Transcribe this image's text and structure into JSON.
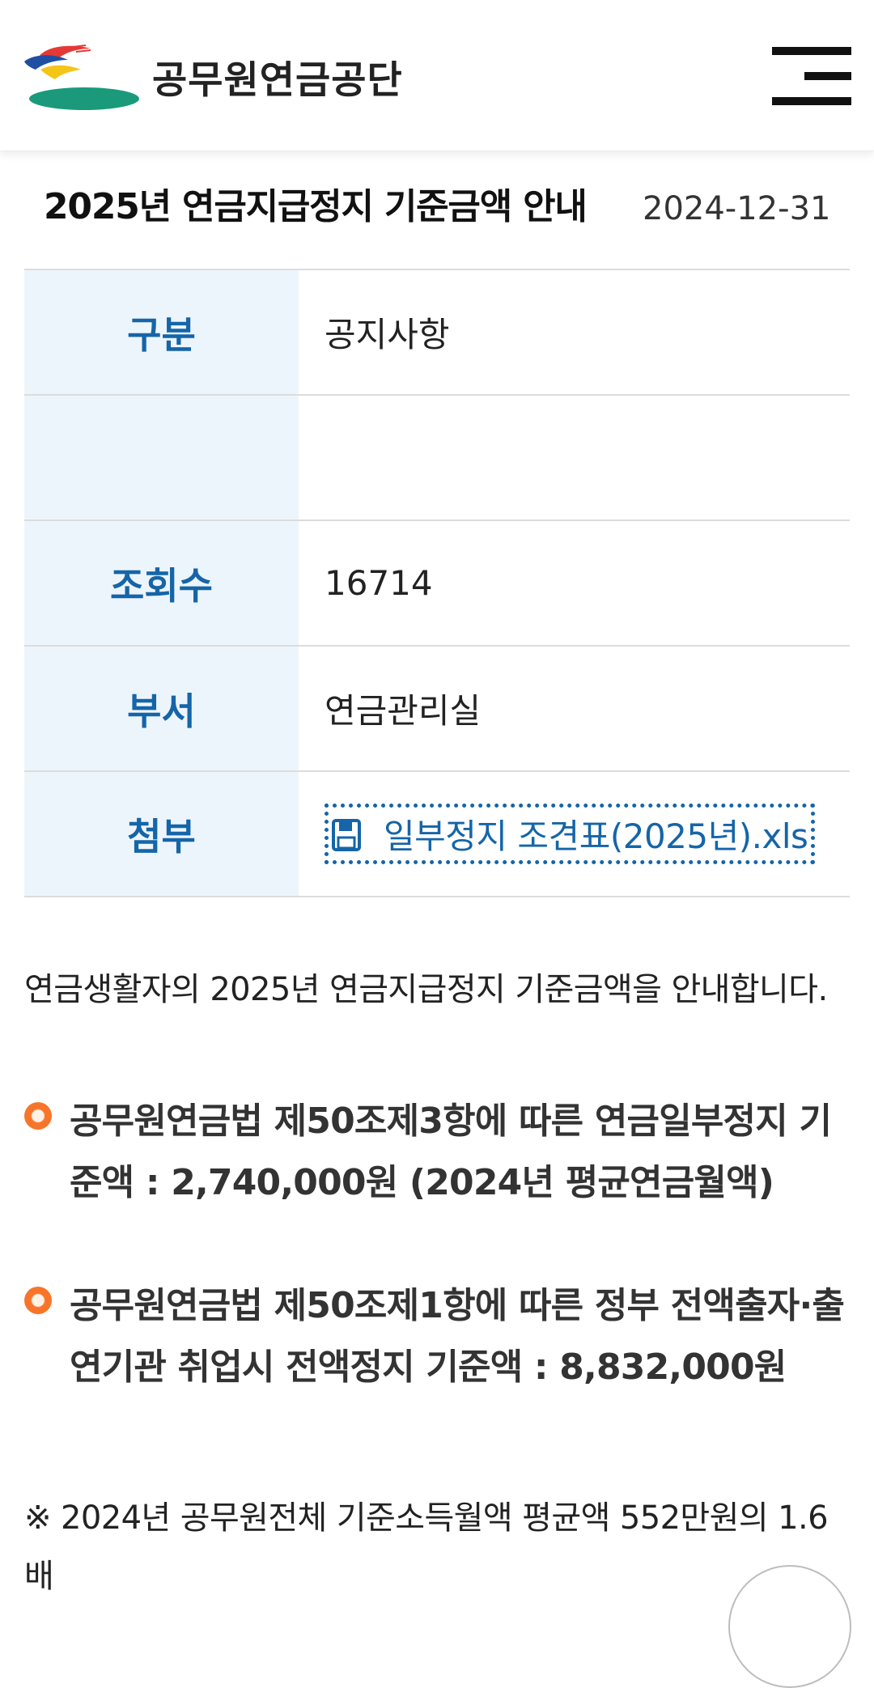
{
  "header": {
    "brand": "공무원연금공단",
    "logo_icon": "gepps-logo",
    "menu_icon": "hamburger-menu-icon"
  },
  "notice": {
    "title": "2025년 연금지급정지 기준금액 안내",
    "date": "2024-12-31"
  },
  "info_table": {
    "rows": [
      {
        "label": "구분",
        "value": "공지사항"
      },
      {
        "label": "",
        "value": ""
      },
      {
        "label": "조회수",
        "value": "16714"
      },
      {
        "label": "부서",
        "value": "연금관리실"
      },
      {
        "label": "첨부",
        "value": "일부정지 조견표(2025년).xls"
      }
    ],
    "attachment_icon": "save-disk-icon"
  },
  "body": {
    "intro": "연금생활자의 2025년 연금지급정지 기준금액을 안내합니다.",
    "bullets": [
      "공무원연금법 제50조제3항에 따른 연금일부정지 기준액 : 2,740,000원 (2024년 평균연금월액)",
      "공무원연금법 제50조제1항에 따른 정부 전액출자·출연기관 취업시 전액정지 기준액 : 8,832,000원"
    ],
    "note": "※ 2024년 공무원전체 기준소득월액 평균액 552만원의 1.6배"
  },
  "colors": {
    "accent_blue": "#1565a8",
    "table_header_bg": "#edf5fc",
    "bullet_orange": "#f7752a"
  }
}
